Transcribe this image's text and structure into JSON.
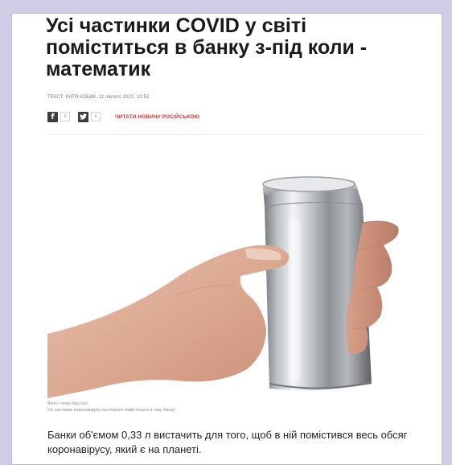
{
  "article": {
    "title": "Усі частинки COVID у світі поміститься в банку з-під коли - математик",
    "byline": "ТЕКСТ: КАТЯ КОБИК, 11 лютого 2021, 10:52",
    "facebook_count": "0",
    "twitter_count": "0",
    "russian_link": "ЧИТАТИ НОВИНУ РОСІЙСЬКОЮ",
    "photo_credit": "Фото: news.sky.com",
    "photo_caption": "Усі частинки коронавірусу на планеті поміститься в таку банку",
    "lead_text": "Банки об'ємом 0,33 л вистачить для того, щоб в ній помістився весь обсяг коронавірусу, який є на планеті."
  },
  "icons": {
    "facebook": "facebook-icon",
    "twitter": "twitter-icon"
  },
  "colors": {
    "accent_link": "#d03a36",
    "frame_background": "#cfcde6"
  }
}
